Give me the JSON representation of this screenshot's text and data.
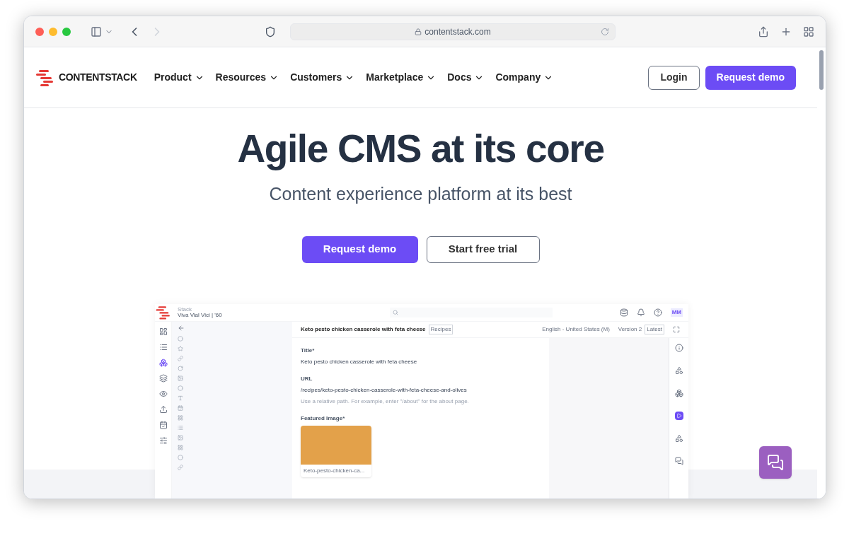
{
  "browser": {
    "url": "contentstack.com"
  },
  "site_nav": {
    "logo": "CONTENTSTACK",
    "menu": [
      "Product",
      "Resources",
      "Customers",
      "Marketplace",
      "Docs",
      "Company"
    ],
    "login": "Login",
    "request_demo": "Request demo"
  },
  "hero": {
    "title": "Agile CMS at its core",
    "subtitle": "Content experience platform at its best",
    "primary_button": "Request demo",
    "secondary_button": "Start free trial"
  },
  "app_preview": {
    "stack_label": "Stack",
    "stack_name": "Viva Vial Vici | '60",
    "avatar": "MM",
    "entry_title": "Keto pesto chicken casserole with feta cheese",
    "content_type": "Recipes",
    "locale": "English - United States (M)",
    "version": "Version 2",
    "version_tag": "Latest",
    "fields": [
      {
        "kind": "text",
        "label": "Title*",
        "value": "Keto pesto chicken casserole with feta cheese"
      },
      {
        "kind": "text",
        "label": "URL",
        "value": "/recipes/keto-pesto-chicken-casserole-with-feta-cheese-and-olives",
        "help": "Use a relative path. For example, enter \"/about\" for the about page."
      },
      {
        "kind": "image",
        "label": "Featured Image*",
        "caption": "Keto-pesto-chicken-ca..."
      }
    ],
    "left_rail": [
      {
        "selected": false
      },
      {
        "selected": false
      },
      {
        "selected": true
      },
      {
        "selected": false
      },
      {
        "selected": false
      },
      {
        "selected": false
      },
      {
        "selected": false
      },
      {
        "selected": false
      }
    ]
  }
}
